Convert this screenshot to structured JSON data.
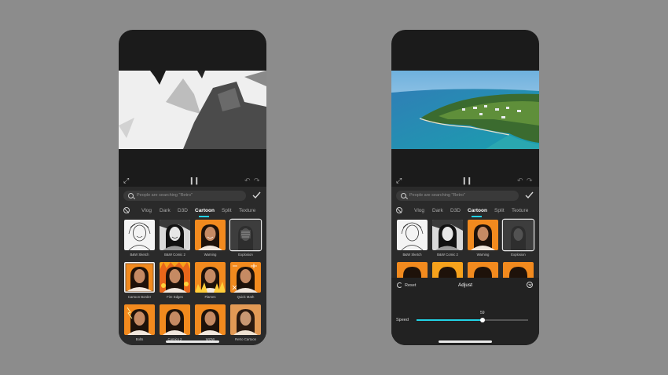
{
  "left_phone": {
    "search_placeholder": "People are searching \"Retro\"",
    "tabs": [
      "Vlog",
      "Dark",
      "D3D",
      "Cartoon",
      "Split",
      "Texture"
    ],
    "active_tab": "Cartoon",
    "effects": [
      "B&W Sketch",
      "B&W Comic 2",
      "Warning",
      "Explosion",
      "Cartoon Border",
      "Fire Edges",
      "Flames",
      "Quick Math",
      "Bolts",
      "Comics 2",
      "WOW",
      "Retro Cartoon"
    ],
    "selected_effect": "Explosion"
  },
  "right_phone": {
    "search_placeholder": "People are searching \"Retro\"",
    "tabs": [
      "Vlog",
      "Dark",
      "D3D",
      "Cartoon",
      "Split",
      "Texture"
    ],
    "active_tab": "Cartoon",
    "effects": [
      "B&W Sketch",
      "B&W Comic 2",
      "Warning",
      "Explosion"
    ],
    "selected_effect": "Explosion",
    "adjust": {
      "reset_label": "Reset",
      "title": "Adjust",
      "speed_label": "Speed",
      "speed_value": "59",
      "speed_fraction": 0.59
    }
  },
  "colors": {
    "accent": "#22d3e6",
    "background": "#8c8c8c",
    "phone_body": "#1b1b1b",
    "panel": "#2a2a2a",
    "thumb_orange": "#f28a1e"
  },
  "icons": {
    "fullscreen": "fullscreen-icon",
    "play_pause": "pause-icon",
    "undo": "undo-icon",
    "redo": "redo-icon",
    "search": "search-icon",
    "confirm": "check-icon",
    "none_effect": "no-effect-icon",
    "reset": "reset-icon",
    "collapse": "collapse-icon"
  }
}
